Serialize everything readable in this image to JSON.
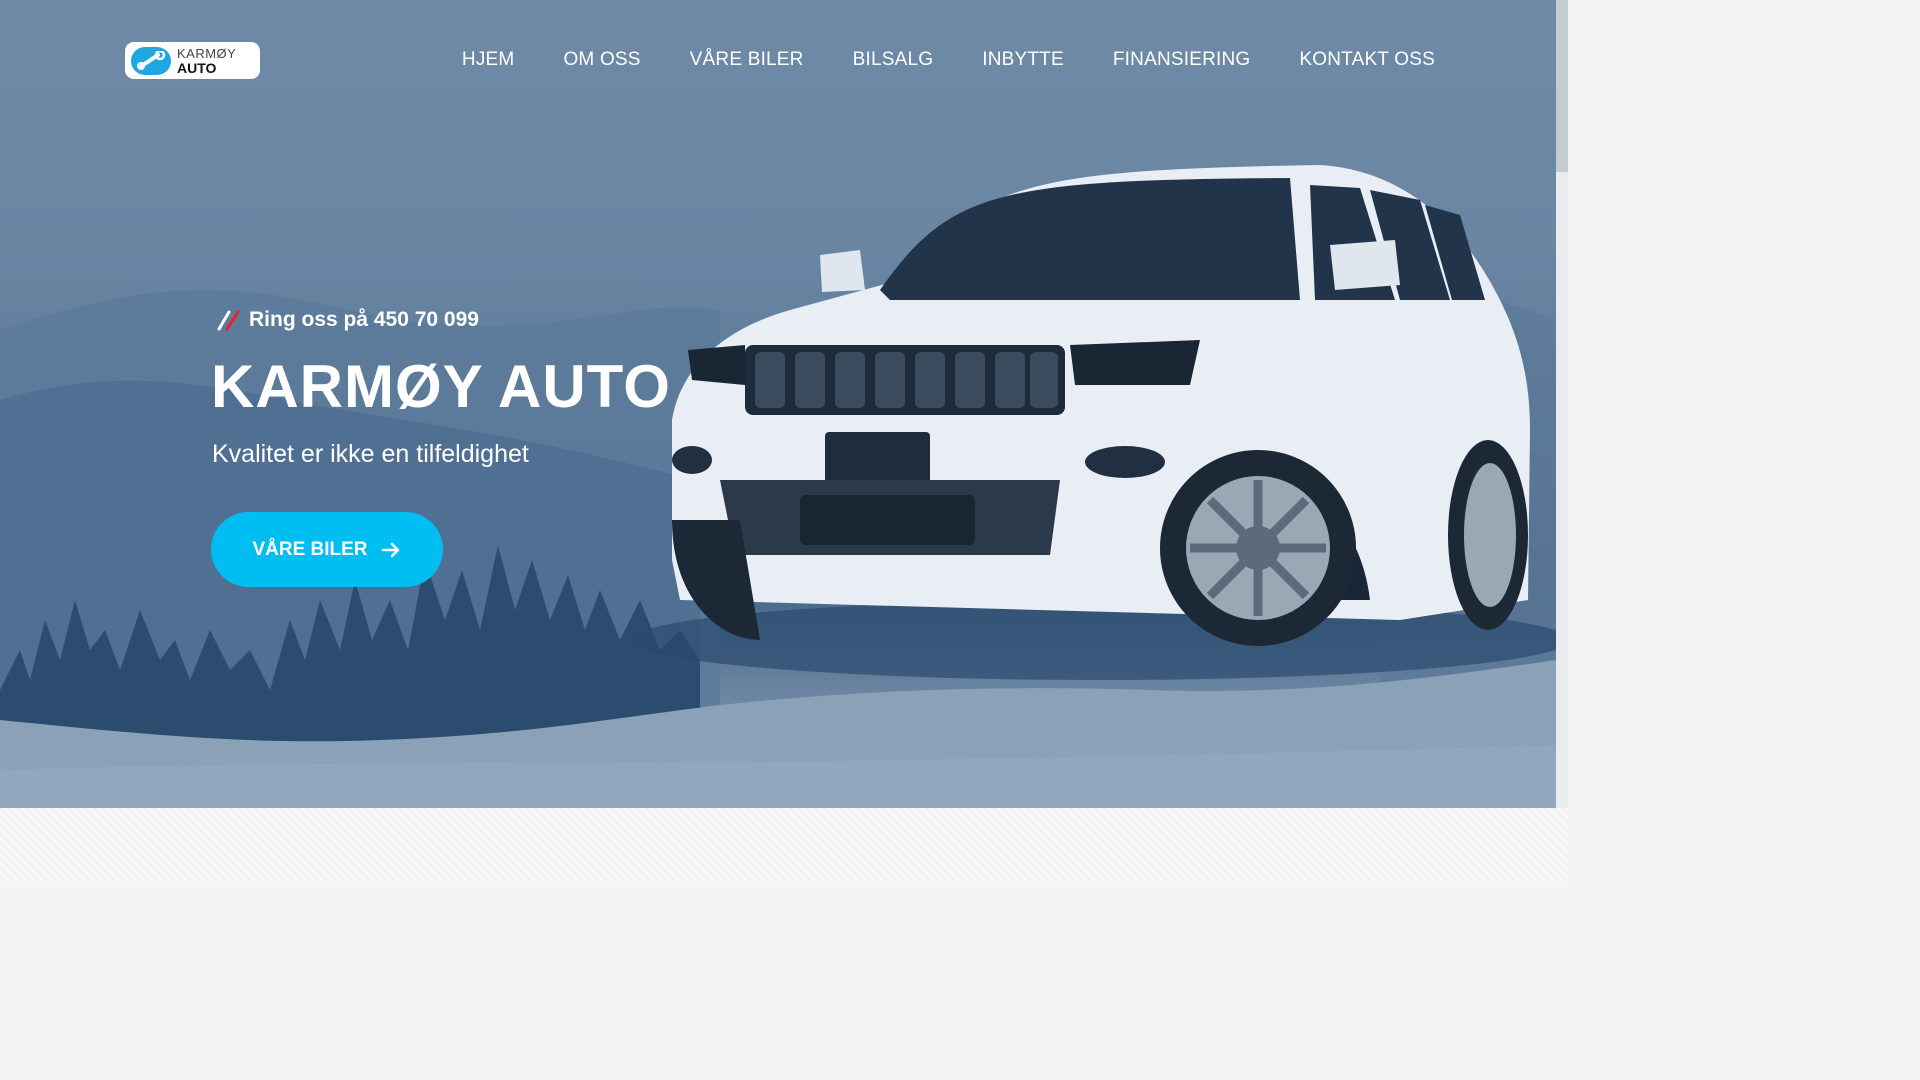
{
  "header": {
    "logo": {
      "line1": "KARMØY",
      "line2": "AUTO",
      "icon": "wrench-icon"
    },
    "nav": [
      {
        "label": "HJEM"
      },
      {
        "label": "OM OSS"
      },
      {
        "label": "VÅRE BILER"
      },
      {
        "label": "BILSALG"
      },
      {
        "label": "INBYTTE"
      },
      {
        "label": "FINANSIERING"
      },
      {
        "label": "KONTAKT OSS"
      }
    ]
  },
  "hero": {
    "phone_text": "Ring oss på 450 70 099",
    "title": "KARMØY AUTO",
    "subtitle": "Kvalitet er ikke en tilfeldighet",
    "cta_label": "VÅRE BILER",
    "cta_icon": "arrow-right-icon"
  },
  "colors": {
    "accent": "#00bdf2",
    "hero_overlay": "#5b7898",
    "slash_light": "#ffffff",
    "slash_red": "#e2262a"
  }
}
